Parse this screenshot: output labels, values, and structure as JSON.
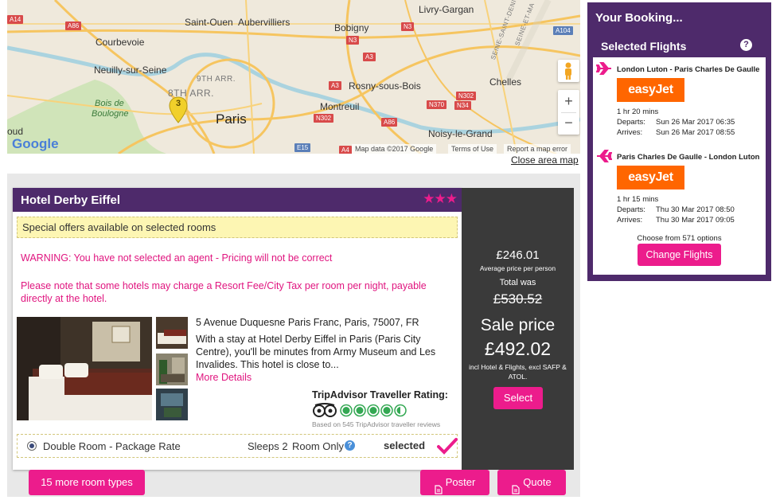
{
  "map": {
    "labels": {
      "livry": "Livry-Gargan",
      "saint_ouen": "Saint-Ouen",
      "aubervilliers": "Aubervilliers",
      "courbevoie": "Courbevoie",
      "bobigny": "Bobigny",
      "neuilly": "Neuilly-sur-Seine",
      "arr9": "9TH ARR.",
      "arr8": "8TH ARR.",
      "rosny": "Rosny-sous-Bois",
      "chelles": "Chelles",
      "bois": "Bois de",
      "boulogne": "Boulogne",
      "paris": "Paris",
      "montreuil": "Montreuil",
      "noisy": "Noisy-le-Grand",
      "oud": "oud",
      "seine_st_denis": "SEINE-SAINT-DENIS",
      "seine_et_ma": "SEINE-ET-MA"
    },
    "roads": {
      "a14": "A14",
      "a86a": "A86",
      "n3a": "N3",
      "n3b": "N3",
      "a104": "A104",
      "a3a": "A3",
      "a3b": "A3",
      "n302a": "N302",
      "n370": "N370",
      "n34": "N34",
      "n302b": "N302",
      "a86b": "A86",
      "e15": "E15",
      "a4": "A4"
    },
    "marker": "3",
    "google": "Google",
    "attribution": "Map data ©2017 Google",
    "terms": "Terms of Use",
    "report": "Report a map error",
    "zoom_in": "+",
    "zoom_out": "−",
    "close_label": "Close area map"
  },
  "hotel": {
    "name": "Hotel Derby Eiffel",
    "stars": "★★★",
    "offer": "Special offers available on selected rooms",
    "warning": "WARNING: You have not selected an agent - Pricing will not be correct",
    "resort_note": "Please note that some hotels may charge a Resort Fee/City Tax per room per night, payable directly at the hotel.",
    "address": "5 Avenue Duquesne Paris Franc, Paris, 75007, FR",
    "description": "With a stay at Hotel Derby Eiffel in Paris (Paris City Centre), you'll be minutes from Army Museum and Les Invalides. This hotel is close to...",
    "more_details": "More Details",
    "tripadvisor": {
      "title": "TripAdvisor Traveller Rating:",
      "rating": 4.5,
      "reviews": "Based on 545 TripAdvisor traveller reviews"
    },
    "room": {
      "name": "Double Room - Package Rate",
      "sleeps": "Sleeps 2",
      "board": "Room Only",
      "status": "selected"
    }
  },
  "price": {
    "per_person": "£246.01",
    "per_person_label": "Average price per person",
    "total_was_label": "Total was",
    "total_was": "£530.52",
    "sale_label": "Sale price",
    "sale_price": "£492.02",
    "includes": "incl Hotel & Flights, excl SAFP & ATOL.",
    "select_label": "Select"
  },
  "actions": {
    "more_rooms": "15 more room types",
    "poster": "Poster",
    "quote": "Quote"
  },
  "booking": {
    "title": "Your Booking...",
    "subtitle": "Selected Flights",
    "help": "?",
    "flights": [
      {
        "route": "London Luton - Paris Charles De Gaulle",
        "airline": "easyJet",
        "duration": "1 hr 20 mins",
        "departs_label": "Departs:",
        "departs": "Sun 26 Mar 2017 06:35",
        "arrives_label": "Arrives:",
        "arrives": "Sun 26 Mar 2017 08:55"
      },
      {
        "route": "Paris Charles De Gaulle - London Luton",
        "airline": "easyJet",
        "duration": "1 hr 15 mins",
        "departs_label": "Departs:",
        "departs": "Thu 30 Mar 2017 08:50",
        "arrives_label": "Arrives:",
        "arrives": "Thu 30 Mar 2017 09:05"
      }
    ],
    "options": "Choose from 571 options",
    "change_label": "Change Flights"
  },
  "colors": {
    "purple": "#4e2a6b",
    "pink": "#ec1c8c",
    "easyjet": "#ff6600",
    "price_bg": "#3a3a3a"
  }
}
